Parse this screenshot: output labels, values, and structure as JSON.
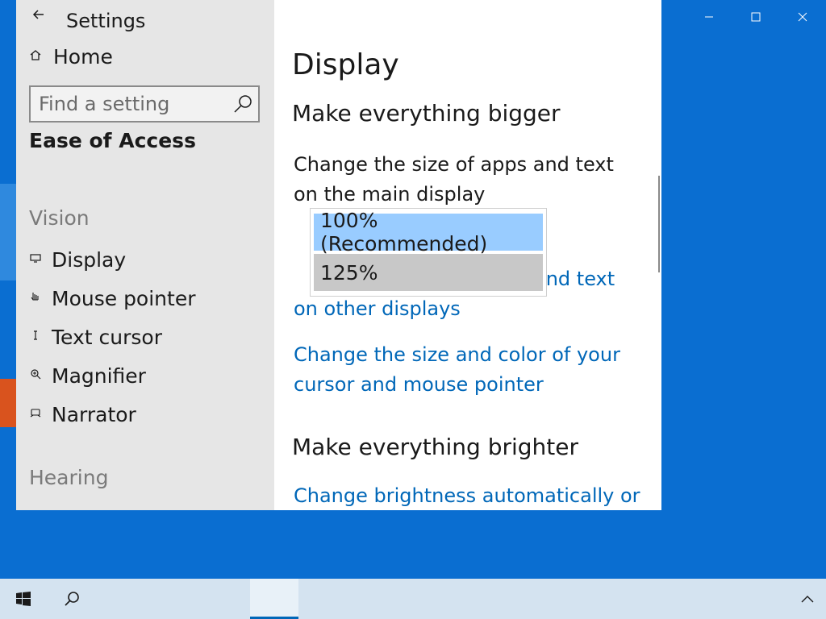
{
  "window": {
    "title": "Settings",
    "caption": {
      "minimize": "—",
      "maximize": "☐",
      "close": "✕"
    }
  },
  "nav": {
    "home_label": "Home",
    "search_placeholder": "Find a setting",
    "section_title": "Ease of Access",
    "groups": [
      {
        "label": "Vision",
        "items": [
          {
            "label": "Display",
            "icon": "monitor-icon"
          },
          {
            "label": "Mouse pointer",
            "icon": "mouse-pointer-icon"
          },
          {
            "label": "Text cursor",
            "icon": "text-cursor-icon"
          },
          {
            "label": "Magnifier",
            "icon": "magnifier-icon"
          },
          {
            "label": "Narrator",
            "icon": "narrator-icon"
          }
        ]
      },
      {
        "label": "Hearing",
        "items": []
      }
    ]
  },
  "content": {
    "page_title": "Display",
    "section1_title": "Make everything bigger",
    "scale_description": "Change the size of apps and text on the main display",
    "scale_options": [
      "100% (Recommended)",
      "125%"
    ],
    "link_other_displays_tail": "and text",
    "link_other_displays_line2": "on other displays",
    "link_cursor": "Change the size and color of your cursor and mouse pointer",
    "section2_title": "Make everything brighter",
    "link_brightness": "Change brightness automatically or"
  },
  "taskbar": {
    "start_icon": "windows-logo-icon",
    "search_icon": "search-icon",
    "tray_icon": "chevron-up-icon"
  },
  "colors": {
    "accent_link": "#0067b8",
    "desktop": "#0a6ed1",
    "nav_bg": "#e6e6e6",
    "selected_option": "#99ccff",
    "hover_option": "#c8c8c8"
  }
}
